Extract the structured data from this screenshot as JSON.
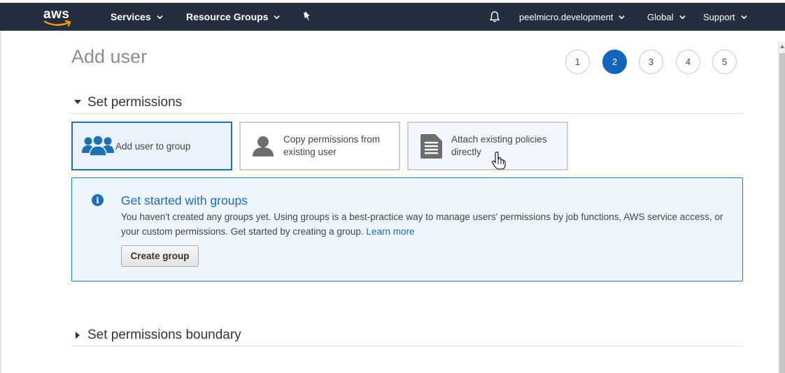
{
  "nav": {
    "logo": "aws",
    "services": "Services",
    "resource_groups": "Resource Groups",
    "pin_icon": "pin-icon",
    "bell_icon": "bell-icon",
    "account": "peelmicro.development",
    "region": "Global",
    "support": "Support"
  },
  "page": {
    "title": "Add user",
    "steps": [
      "1",
      "2",
      "3",
      "4",
      "5"
    ],
    "active_step": "2"
  },
  "permissions": {
    "section_title": "Set permissions",
    "options": [
      {
        "label": "Add user to group",
        "icon": "group-icon",
        "selected": true
      },
      {
        "label": "Copy permissions from existing user",
        "label_line1": "Copy permissions from",
        "label_line2": "existing user",
        "icon": "user-icon",
        "selected": false
      },
      {
        "label": "Attach existing policies directly",
        "label_line1": "Attach existing policies",
        "label_line2": "directly",
        "icon": "document-icon",
        "selected": false
      }
    ]
  },
  "info": {
    "title": "Get started with groups",
    "body": "You haven't created any groups yet. Using groups is a best-practice way to manage users' permissions by job functions, AWS service access, or your custom permissions. Get started by creating a group.",
    "link": "Learn more",
    "button": "Create group"
  },
  "boundary": {
    "section_title": "Set permissions boundary"
  },
  "colors": {
    "nav_bg": "#232f3e",
    "accent": "#1166bb",
    "info_bg": "#eef6fd"
  }
}
